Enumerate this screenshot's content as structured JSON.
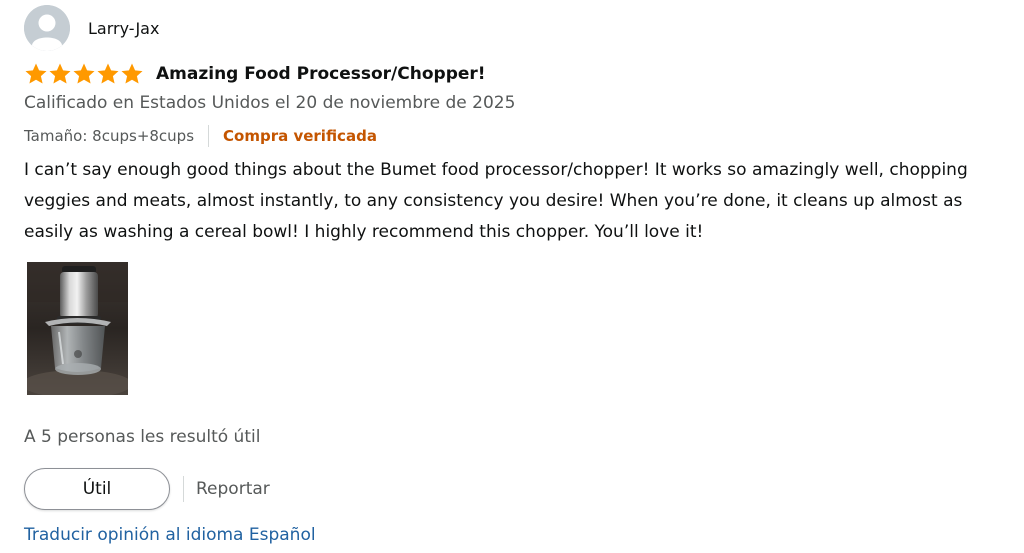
{
  "colors": {
    "star": "#ff9900",
    "verified": "#c45500",
    "link": "#2162a1",
    "secondary_text": "#565959",
    "primary_text": "#0f1111"
  },
  "review": {
    "reviewer_name": "Larry-Jax",
    "avatar_icon": "default-profile-icon",
    "rating": 5,
    "rating_max": 5,
    "title": "Amazing Food Processor/Chopper!",
    "date_text": "Calificado en Estados Unidos el 20 de noviembre de 2025",
    "variant_text": "Tamaño: 8cups+8cups",
    "verified_text": "Compra verificada",
    "body": "I can’t say enough good things about the Bumet food processor/chopper! It works so amazingly well, chopping veggies and meats, almost instantly, to any consistency you desire! When you’re done, it cleans up almost as easily as washing a cereal bowl! I highly recommend this chopper. You’ll love it!",
    "image_icon": "review-photo-food-chopper",
    "helpful_count_text": "A 5 personas les resultó útil",
    "helpful_button_label": "Útil",
    "report_label": "Reportar",
    "translate_label": "Traducir opinión al idioma Español"
  }
}
